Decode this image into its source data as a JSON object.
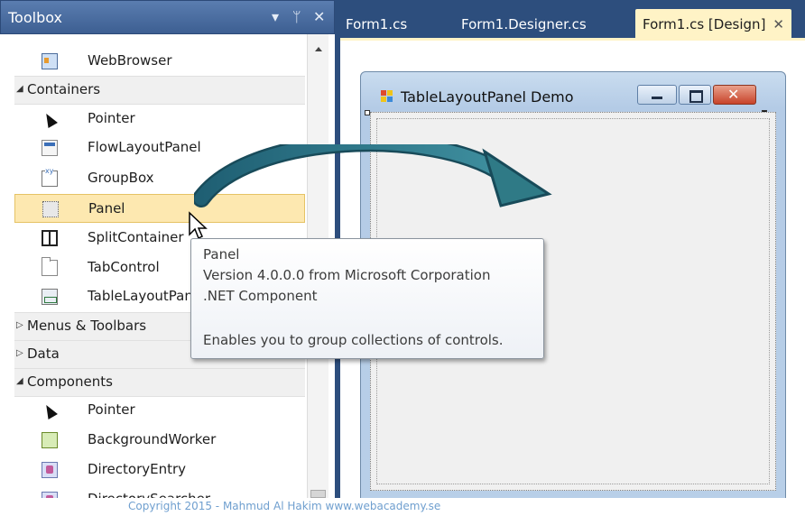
{
  "toolbox": {
    "title": "Toolbox",
    "controls": {
      "dropdown": "▾",
      "pin": "ᛘ",
      "close": "✕"
    },
    "items": [
      {
        "kind": "item",
        "label": "WebBrowser",
        "icon": "web-browser-icon"
      },
      {
        "kind": "category",
        "label": "Containers",
        "expanded": true
      },
      {
        "kind": "item",
        "label": "Pointer",
        "icon": "pointer-icon"
      },
      {
        "kind": "item",
        "label": "FlowLayoutPanel",
        "icon": "flow-layout-panel-icon"
      },
      {
        "kind": "item",
        "label": "GroupBox",
        "icon": "group-box-icon"
      },
      {
        "kind": "item",
        "label": "Panel",
        "icon": "panel-icon",
        "selected": true
      },
      {
        "kind": "item",
        "label": "SplitContainer",
        "icon": "split-container-icon"
      },
      {
        "kind": "item",
        "label": "TabControl",
        "icon": "tab-control-icon"
      },
      {
        "kind": "item",
        "label": "TableLayoutPanel",
        "icon": "table-layout-panel-icon"
      },
      {
        "kind": "category",
        "label": "Menus & Toolbars",
        "expanded": false
      },
      {
        "kind": "category",
        "label": "Data",
        "expanded": false
      },
      {
        "kind": "category",
        "label": "Components",
        "expanded": true
      },
      {
        "kind": "item",
        "label": "Pointer",
        "icon": "pointer-icon"
      },
      {
        "kind": "item",
        "label": "BackgroundWorker",
        "icon": "background-worker-icon"
      },
      {
        "kind": "item",
        "label": "DirectoryEntry",
        "icon": "directory-entry-icon"
      },
      {
        "kind": "item",
        "label": "DirectorySearcher",
        "icon": "directory-searcher-icon"
      }
    ]
  },
  "tabs": [
    {
      "label": "Form1.cs",
      "active": false
    },
    {
      "label": "Form1.Designer.cs",
      "active": false
    },
    {
      "label": "Form1.cs [Design]",
      "active": true
    }
  ],
  "form": {
    "title": "TableLayoutPanel Demo"
  },
  "tooltip": {
    "lines": [
      "Panel",
      "Version 4.0.0.0 from Microsoft Corporation",
      ".NET Component",
      "",
      "Enables you to group collections of controls."
    ]
  },
  "footer": {
    "copyright": "Copyright 2015 - Mahmud Al Hakim www.webacademy.se"
  },
  "colors": {
    "title_bar": "#3d5f92",
    "selection": "#fde8b0",
    "active_tab": "#fff3c6",
    "arrow": "#2f7a86"
  }
}
